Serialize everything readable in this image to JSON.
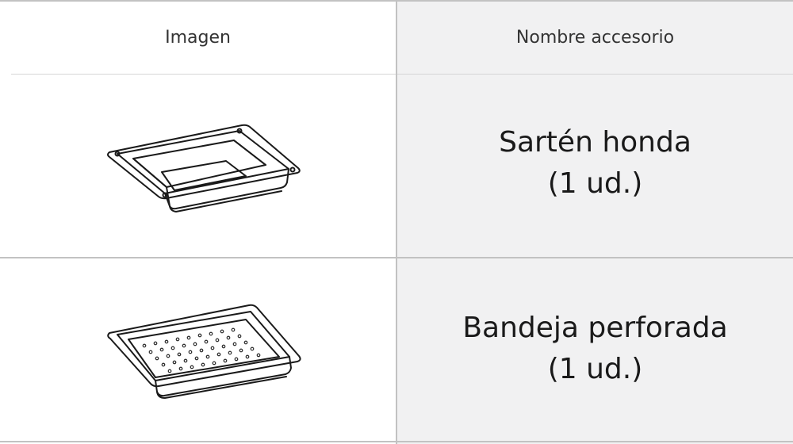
{
  "header": {
    "image_col": "Imagen",
    "name_col": "Nombre accesorio"
  },
  "rows": [
    {
      "icon": "deep-pan-icon",
      "name": "Sartén honda",
      "qty": "(1 ud.)"
    },
    {
      "icon": "perforated-tray-icon",
      "name": "Bandeja perforada",
      "qty": "(1 ud.)"
    }
  ]
}
